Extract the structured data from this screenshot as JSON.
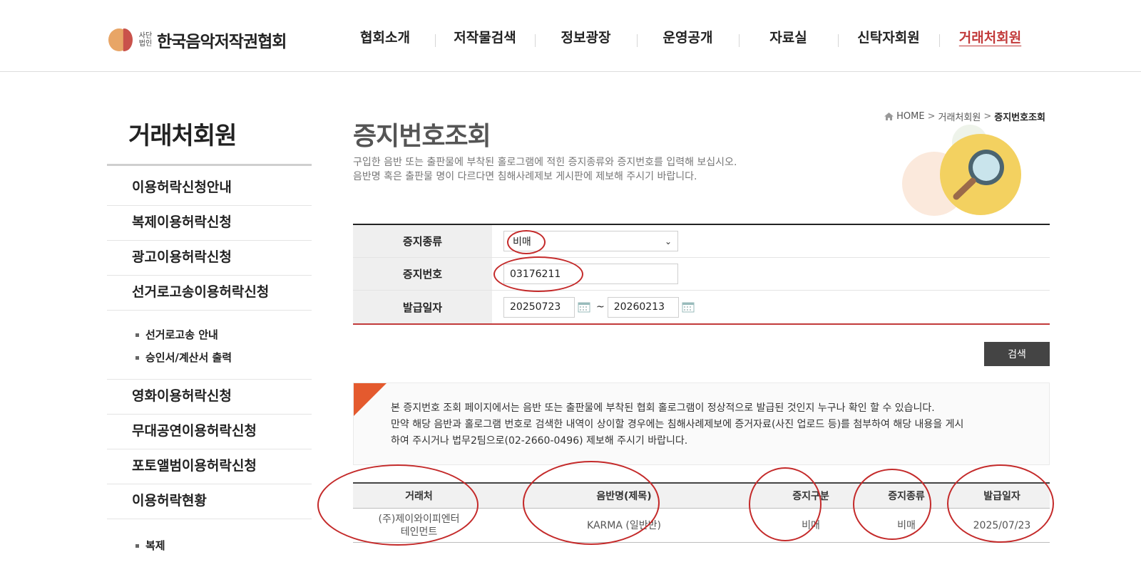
{
  "header": {
    "logo_sub_line1": "사단",
    "logo_sub_line2": "법인",
    "logo_name": "한국음악저작권협회",
    "nav": [
      {
        "label": "협회소개"
      },
      {
        "label": "저작물검색"
      },
      {
        "label": "정보광장"
      },
      {
        "label": "운영공개"
      },
      {
        "label": "자료실"
      },
      {
        "label": "신탁자회원"
      },
      {
        "label": "거래처회원"
      }
    ]
  },
  "sidebar": {
    "title": "거래처회원",
    "items": [
      {
        "label": "이용허락신청안내"
      },
      {
        "label": "복제이용허락신청"
      },
      {
        "label": "광고이용허락신청"
      },
      {
        "label": "선거로고송이용허락신청"
      }
    ],
    "subitems": [
      {
        "label": "선거로고송 안내"
      },
      {
        "label": "승인서/계산서 출력"
      }
    ],
    "items2": [
      {
        "label": "영화이용허락신청"
      },
      {
        "label": "무대공연이용허락신청"
      },
      {
        "label": "포토앨범이용허락신청"
      },
      {
        "label": "이용허락현황"
      }
    ],
    "sub_bottom": "복제"
  },
  "main": {
    "title": "증지번호조회",
    "desc_line1": "구입한 음반 또는 출판물에 부착된 홀로그램에 적힌 증지종류와 증지번호를 입력해 보십시오.",
    "desc_line2": "음반명 혹은 출판물 명이 다르다면 침해사례제보 게시판에 제보해 주시기 바랍니다.",
    "breadcrumb": {
      "home": "HOME",
      "sep": ">",
      "parent": "거래처회원",
      "current": "증지번호조회"
    },
    "form": {
      "type_label": "증지종류",
      "type_value": "비매",
      "number_label": "증지번호",
      "number_value": "03176211",
      "date_label": "발급일자",
      "date_from": "20250723",
      "date_tilde": "~",
      "date_to": "20260213"
    },
    "search_label": "검색",
    "notice": {
      "line1": "본 증지번호 조회 페이지에서는 음반 또는 출판물에 부착된 협회 홀로그램이 정상적으로 발급된 것인지 누구나 확인 할 수 있습니다.",
      "line2": "만약 해당 음반과 홀로그램 번호로 검색한 내역이 상이할 경우에는 침해사례제보에 증거자료(사진 업로드 등)를 첨부하여 해당 내용을 게시",
      "line3": "하여 주시거나 법무2팀으로(02-2660-0496) 제보해 주시기 바랍니다."
    },
    "table": {
      "headers": [
        "거래처",
        "음반명(제목)",
        "증지구분",
        "증지종류",
        "발급일자"
      ],
      "row": {
        "client_line1": "(주)제이와이피엔터",
        "client_line2": "테인먼트",
        "album": "KARMA (일반반)",
        "category": "비매",
        "type": "비매",
        "date": "2025/07/23"
      }
    }
  },
  "colors": {
    "accent_red": "#c23a3a",
    "annotation_red": "#c42a2a",
    "notice_orange": "#e45a2e",
    "button_dark": "#444444"
  }
}
